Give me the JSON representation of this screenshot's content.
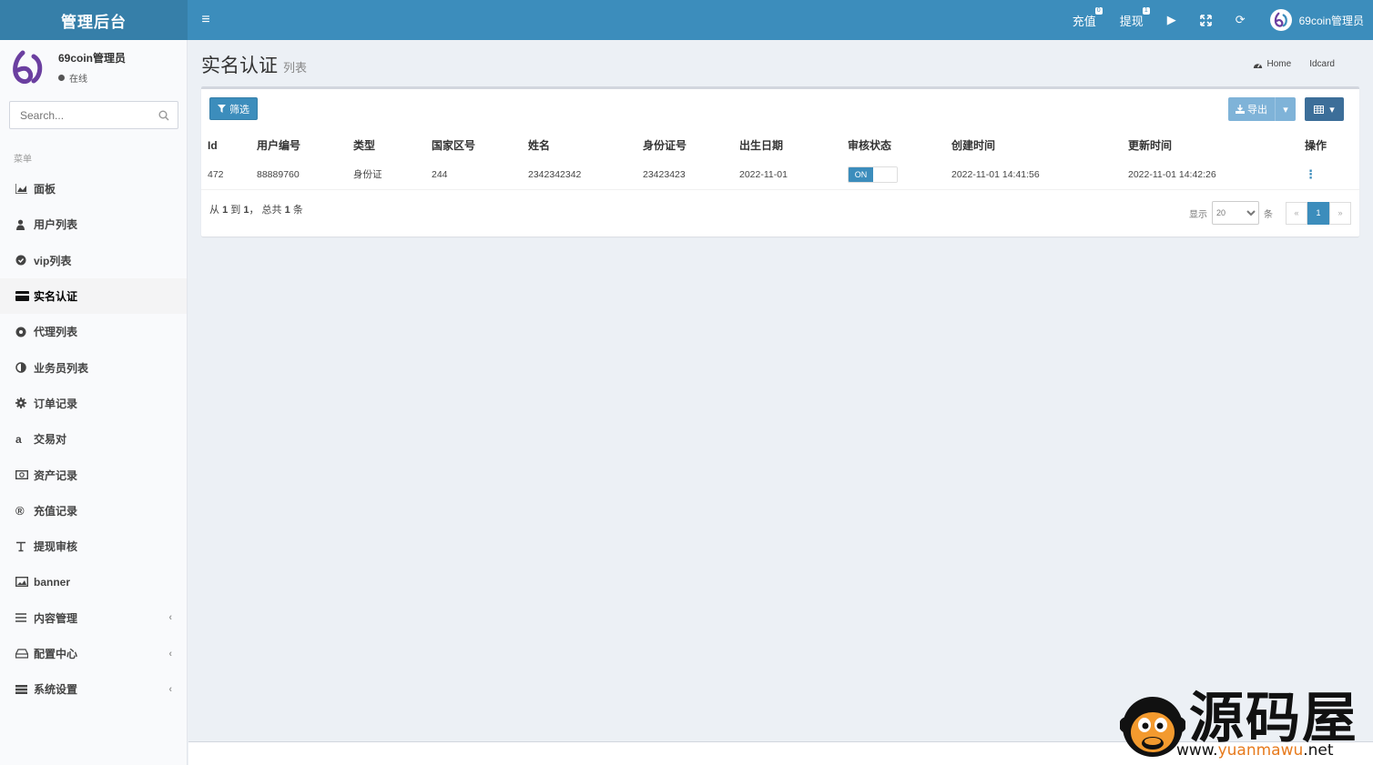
{
  "header": {
    "brand": "管理后台",
    "recharge_label": "充值",
    "recharge_badge": "0",
    "withdraw_label": "提现",
    "withdraw_badge": "1",
    "user_name": "69coin管理员"
  },
  "sidebar": {
    "user_name": "69coin管理员",
    "user_status": "在线",
    "search_placeholder": "Search...",
    "menu_header": "菜单",
    "items": [
      {
        "label": "面板",
        "icon": "area-chart-icon"
      },
      {
        "label": "用户列表",
        "icon": "user-icon"
      },
      {
        "label": "vip列表",
        "icon": "check-circle-icon"
      },
      {
        "label": "实名认证",
        "icon": "credit-card-icon"
      },
      {
        "label": "代理列表",
        "icon": "gear-circle-icon"
      },
      {
        "label": "业务员列表",
        "icon": "adjust-icon"
      },
      {
        "label": "订单记录",
        "icon": "cogs-icon"
      },
      {
        "label": "交易对",
        "icon": "amazon-icon"
      },
      {
        "label": "资产记录",
        "icon": "money-icon"
      },
      {
        "label": "充值记录",
        "icon": "registered-icon"
      },
      {
        "label": "提现审核",
        "icon": "text-icon"
      },
      {
        "label": "banner",
        "icon": "image-icon"
      },
      {
        "label": "内容管理",
        "icon": "bars-icon"
      },
      {
        "label": "配置中心",
        "icon": "hdd-icon"
      },
      {
        "label": "系统设置",
        "icon": "list-icon"
      }
    ]
  },
  "page": {
    "title": "实名认证",
    "subtitle": "列表",
    "breadcrumb_home": "Home",
    "breadcrumb_current": "Idcard"
  },
  "toolbar": {
    "filter_label": "筛选",
    "export_label": "导出"
  },
  "table": {
    "columns": [
      "Id",
      "用户编号",
      "类型",
      "国家区号",
      "姓名",
      "身份证号",
      "出生日期",
      "审核状态",
      "创建时间",
      "更新时间",
      "操作"
    ],
    "rows": [
      {
        "id": "472",
        "user_no": "88889760",
        "type": "身份证",
        "area_code": "244",
        "name": "2342342342",
        "id_no": "23423423",
        "birth": "2022-11-01",
        "status": "ON",
        "created": "2022-11-01 14:41:56",
        "updated": "2022-11-01 14:42:26"
      }
    ]
  },
  "pagination": {
    "info_prefix": "从",
    "info_from": "1",
    "info_to_word": "到",
    "info_to": "1",
    "info_total_word": "， 总共",
    "info_total": "1",
    "info_suffix": "条",
    "show_label": "显示",
    "page_size": "20",
    "unit": "条",
    "prev": "«",
    "current": "1",
    "next": "»"
  },
  "watermark": {
    "text": "源码屋",
    "url_prefix": "www.",
    "url_mid": "yuanmawu",
    "url_suffix": ".net"
  }
}
